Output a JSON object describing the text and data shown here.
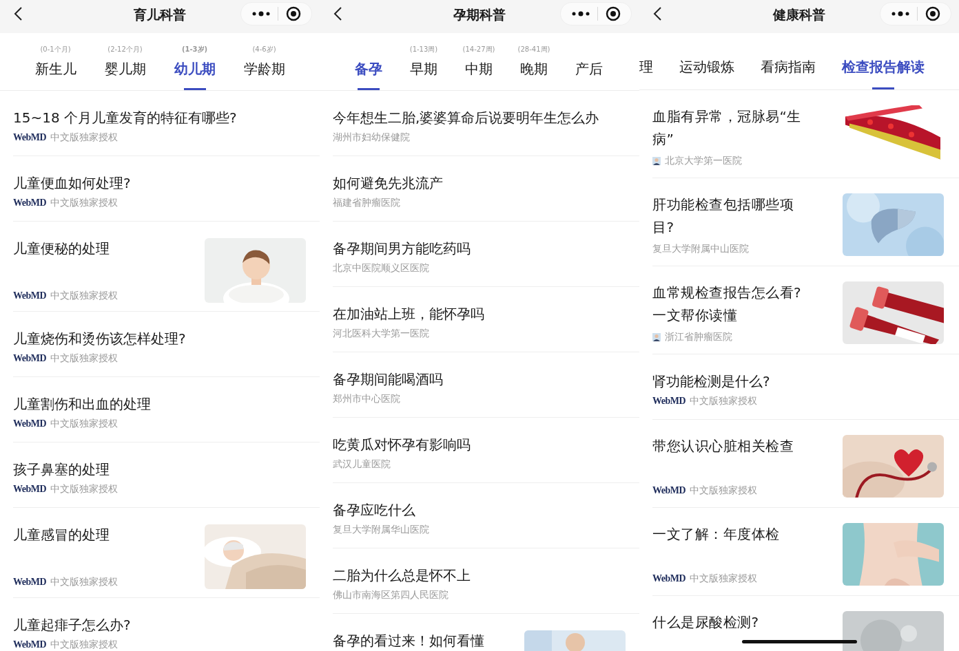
{
  "panels": [
    {
      "title": "育儿科普",
      "tabs": [
        {
          "sublabel": "(0-1个月)",
          "label": "新生儿",
          "selected": false
        },
        {
          "sublabel": "(2-12个月)",
          "label": "婴儿期",
          "selected": false
        },
        {
          "sublabel": "(1-3岁)",
          "label": "幼儿期",
          "selected": true
        },
        {
          "sublabel": "(4-6岁)",
          "label": "学龄期",
          "selected": false
        }
      ],
      "articles": [
        {
          "title": "15~18 个月儿童发育的特征有哪些?",
          "source": {
            "kind": "webmd",
            "logo": "WebMD",
            "text": "中文版独家授权"
          },
          "picture": false
        },
        {
          "title": "儿童便血如何处理?",
          "source": {
            "kind": "webmd",
            "logo": "WebMD",
            "text": "中文版独家授权"
          },
          "picture": false
        },
        {
          "title": "儿童便秘的处理",
          "source": {
            "kind": "webmd",
            "logo": "WebMD",
            "text": "中文版独家授权"
          },
          "picture": true
        },
        {
          "title": "儿童烧伤和烫伤该怎样处理?",
          "source": {
            "kind": "webmd",
            "logo": "WebMD",
            "text": "中文版独家授权"
          },
          "picture": false
        },
        {
          "title": "儿童割伤和出血的处理",
          "source": {
            "kind": "webmd",
            "logo": "WebMD",
            "text": "中文版独家授权"
          },
          "picture": false
        },
        {
          "title": "孩子鼻塞的处理",
          "source": {
            "kind": "webmd",
            "logo": "WebMD",
            "text": "中文版独家授权"
          },
          "picture": false
        },
        {
          "title": "儿童感冒的处理",
          "source": {
            "kind": "webmd",
            "logo": "WebMD",
            "text": "中文版独家授权"
          },
          "picture": true
        },
        {
          "title": "儿童起痱子怎么办?",
          "source": {
            "kind": "webmd",
            "logo": "WebMD",
            "text": "中文版独家授权"
          },
          "picture": false
        }
      ]
    },
    {
      "title": "孕期科普",
      "tabs": [
        {
          "label": "备孕",
          "selected": true
        },
        {
          "sublabel": "(1-13周)",
          "label": "早期",
          "selected": false
        },
        {
          "sublabel": "(14-27周)",
          "label": "中期",
          "selected": false
        },
        {
          "sublabel": "(28-41周)",
          "label": "晚期",
          "selected": false
        },
        {
          "label": "产后",
          "selected": false
        }
      ],
      "articles": [
        {
          "title": "今年想生二胎,婆婆算命后说要明年生怎么办",
          "source": {
            "kind": "plain",
            "text": "湖州市妇幼保健院"
          },
          "picture": false
        },
        {
          "title": "如何避免先兆流产",
          "source": {
            "kind": "plain",
            "text": "福建省肿瘤医院"
          },
          "picture": false
        },
        {
          "title": "备孕期间男方能吃药吗",
          "source": {
            "kind": "plain",
            "text": "北京中医院顺义区医院"
          },
          "picture": false
        },
        {
          "title": "在加油站上班，能怀孕吗",
          "source": {
            "kind": "plain",
            "text": "河北医科大学第一医院"
          },
          "picture": false
        },
        {
          "title": "备孕期间能喝酒吗",
          "source": {
            "kind": "plain",
            "text": "郑州市中心医院"
          },
          "picture": false
        },
        {
          "title": "吃黄瓜对怀孕有影响吗",
          "source": {
            "kind": "plain",
            "text": "武汉儿童医院"
          },
          "picture": false
        },
        {
          "title": "备孕应吃什么",
          "source": {
            "kind": "plain",
            "text": "复旦大学附属华山医院"
          },
          "picture": false
        },
        {
          "title": "二胎为什么总是怀不上",
          "source": {
            "kind": "plain",
            "text": "佛山市南海区第四人民医院"
          },
          "picture": false
        },
        {
          "title": "备孕的看过来！如何看懂",
          "picture": true
        }
      ]
    },
    {
      "title": "健康科普",
      "tabs": [
        {
          "label": "理",
          "selected": false
        },
        {
          "label": "运动锻炼",
          "selected": false
        },
        {
          "label": "看病指南",
          "selected": false
        },
        {
          "label": "检查报告解读",
          "selected": true
        }
      ],
      "articles": [
        {
          "title": "血脂有异常，冠脉易“生病”",
          "source": {
            "kind": "avatar",
            "text": "北京大学第一医院"
          },
          "picture": true
        },
        {
          "title": "肝功能检查包括哪些项目?",
          "source": {
            "kind": "plain",
            "text": "复旦大学附属中山医院"
          },
          "picture": true
        },
        {
          "title": "血常规检查报告怎么看?一文帮你读懂",
          "source": {
            "kind": "avatar",
            "text": "浙江省肿瘤医院"
          },
          "picture": true
        },
        {
          "title": "肾功能检测是什么?",
          "source": {
            "kind": "webmd",
            "logo": "WebMD",
            "text": "中文版独家授权"
          },
          "picture": false
        },
        {
          "title": "带您认识心脏相关检查",
          "source": {
            "kind": "webmd",
            "logo": "WebMD",
            "text": "中文版独家授权"
          },
          "picture": true
        },
        {
          "title": "一文了解：年度体检",
          "source": {
            "kind": "webmd",
            "logo": "WebMD",
            "text": "中文版独家授权"
          },
          "picture": true
        },
        {
          "title": "什么是尿酸检测?",
          "picture": true
        }
      ],
      "home_bar": true
    }
  ]
}
